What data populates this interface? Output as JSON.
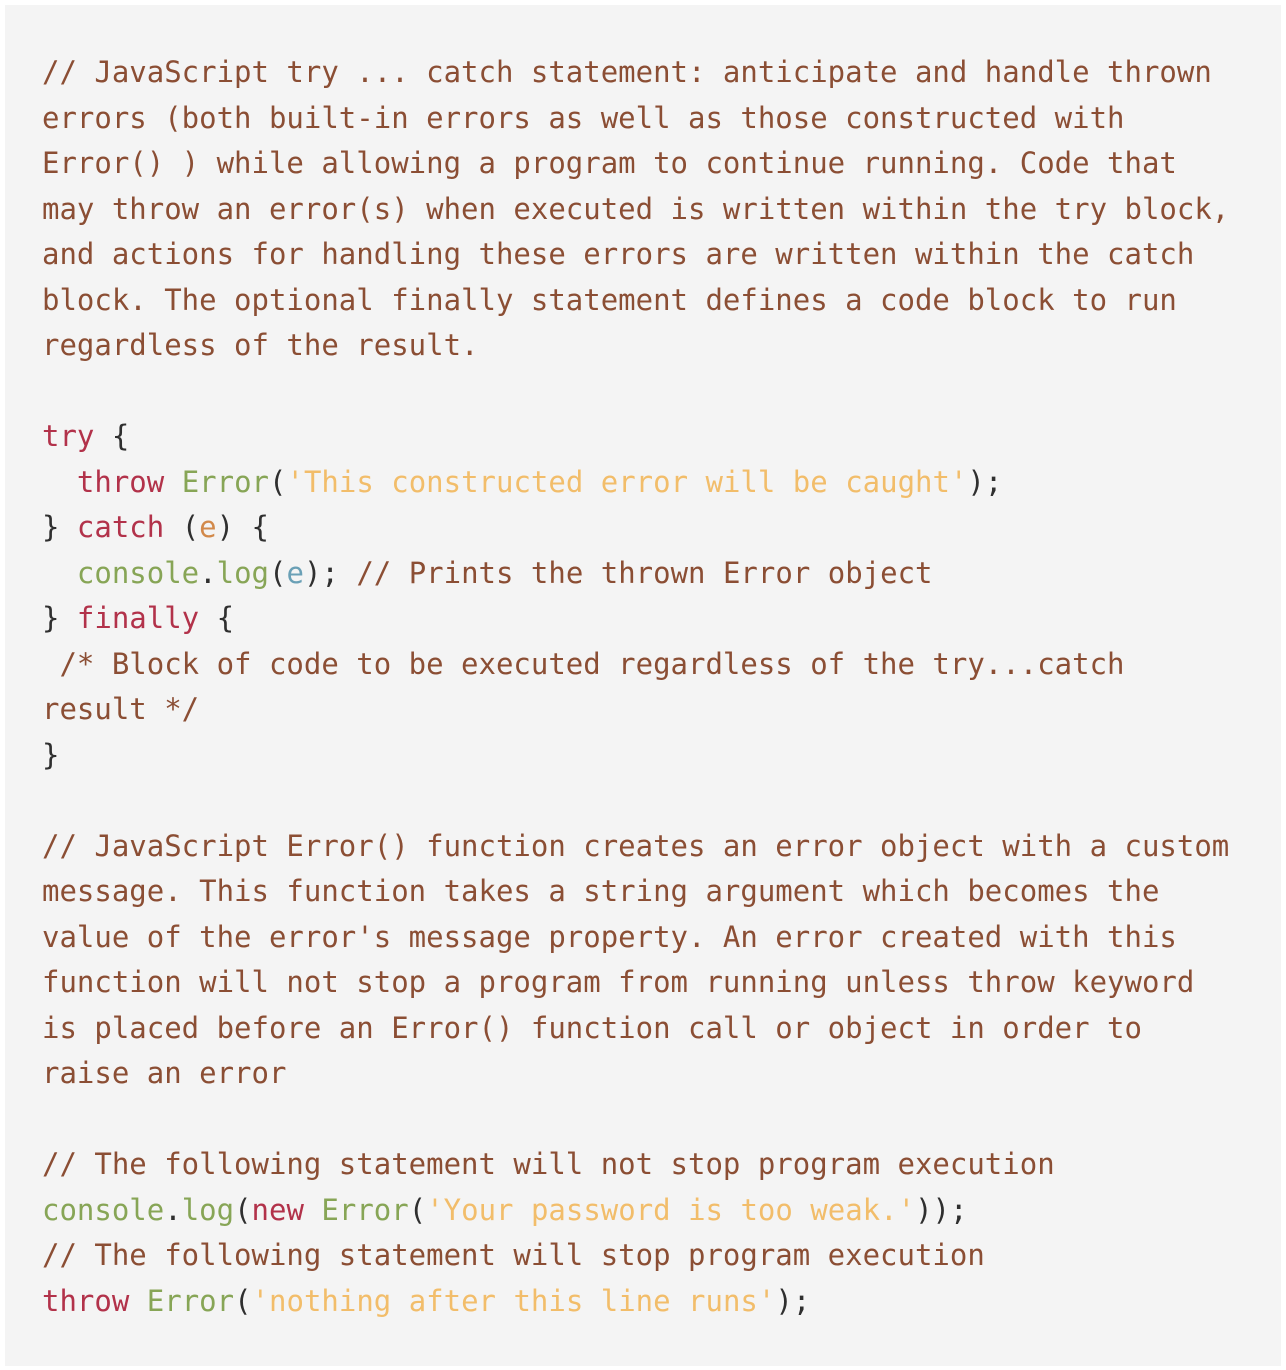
{
  "code_lines": [
    [
      {
        "t": "comment",
        "v": "// JavaScript try ... catch statement: anticipate and handle thrown"
      }
    ],
    [
      {
        "t": "comment",
        "v": "errors (both built-in errors as well as those constructed with"
      }
    ],
    [
      {
        "t": "comment",
        "v": "Error() ) while allowing a program to continue running. Code that"
      }
    ],
    [
      {
        "t": "comment",
        "v": "may throw an error(s) when executed is written within the try block,"
      }
    ],
    [
      {
        "t": "comment",
        "v": "and actions for handling these errors are written within the catch"
      }
    ],
    [
      {
        "t": "comment",
        "v": "block. The optional finally statement defines a code block to run"
      }
    ],
    [
      {
        "t": "comment",
        "v": "regardless of the result."
      }
    ],
    [],
    [
      {
        "t": "keyword",
        "v": "try"
      },
      {
        "t": "punct",
        "v": " {"
      }
    ],
    [
      {
        "t": "punct",
        "v": "  "
      },
      {
        "t": "keyword",
        "v": "throw"
      },
      {
        "t": "punct",
        "v": " "
      },
      {
        "t": "fn",
        "v": "Error"
      },
      {
        "t": "punct",
        "v": "("
      },
      {
        "t": "str",
        "v": "'This constructed error will be caught'"
      },
      {
        "t": "punct",
        "v": ");"
      }
    ],
    [
      {
        "t": "punct",
        "v": "} "
      },
      {
        "t": "keyword",
        "v": "catch"
      },
      {
        "t": "punct",
        "v": " ("
      },
      {
        "t": "param",
        "v": "e"
      },
      {
        "t": "punct",
        "v": ") {"
      }
    ],
    [
      {
        "t": "punct",
        "v": "  "
      },
      {
        "t": "fn",
        "v": "console"
      },
      {
        "t": "punct",
        "v": "."
      },
      {
        "t": "fn",
        "v": "log"
      },
      {
        "t": "punct",
        "v": "("
      },
      {
        "t": "var",
        "v": "e"
      },
      {
        "t": "punct",
        "v": "); "
      },
      {
        "t": "comment",
        "v": "// Prints the thrown Error object"
      }
    ],
    [
      {
        "t": "punct",
        "v": "} "
      },
      {
        "t": "keyword",
        "v": "finally"
      },
      {
        "t": "punct",
        "v": " {"
      }
    ],
    [
      {
        "t": "comment",
        "v": " /* Block of code to be executed regardless of the try...catch"
      }
    ],
    [
      {
        "t": "comment",
        "v": "result */"
      }
    ],
    [
      {
        "t": "punct",
        "v": "}"
      }
    ],
    [],
    [
      {
        "t": "comment",
        "v": "// JavaScript Error() function creates an error object with a custom"
      }
    ],
    [
      {
        "t": "comment",
        "v": "message. This function takes a string argument which becomes the"
      }
    ],
    [
      {
        "t": "comment",
        "v": "value of the error's message property. An error created with this"
      }
    ],
    [
      {
        "t": "comment",
        "v": "function will not stop a program from running unless throw keyword"
      }
    ],
    [
      {
        "t": "comment",
        "v": "is placed before an Error() function call or object in order to"
      }
    ],
    [
      {
        "t": "comment",
        "v": "raise an error"
      }
    ],
    [],
    [
      {
        "t": "comment",
        "v": "// The following statement will not stop program execution"
      }
    ],
    [
      {
        "t": "fn",
        "v": "console"
      },
      {
        "t": "punct",
        "v": "."
      },
      {
        "t": "fn",
        "v": "log"
      },
      {
        "t": "punct",
        "v": "("
      },
      {
        "t": "keyword",
        "v": "new"
      },
      {
        "t": "punct",
        "v": " "
      },
      {
        "t": "fn",
        "v": "Error"
      },
      {
        "t": "punct",
        "v": "("
      },
      {
        "t": "str",
        "v": "'Your password is too weak.'"
      },
      {
        "t": "punct",
        "v": "));"
      }
    ],
    [
      {
        "t": "comment",
        "v": "// The following statement will stop program execution"
      }
    ],
    [
      {
        "t": "keyword",
        "v": "throw"
      },
      {
        "t": "punct",
        "v": " "
      },
      {
        "t": "fn",
        "v": "Error"
      },
      {
        "t": "punct",
        "v": "("
      },
      {
        "t": "str",
        "v": "'nothing after this line runs'"
      },
      {
        "t": "punct",
        "v": ");"
      }
    ]
  ],
  "colors": {
    "background": "#f4f4f4",
    "comment": "#8b4e34",
    "keyword": "#b2324a",
    "function": "#87a556",
    "string": "#f2bd6a",
    "param": "#d2894a",
    "variable": "#6aa0b6",
    "punctuation": "#2f2f2f"
  }
}
